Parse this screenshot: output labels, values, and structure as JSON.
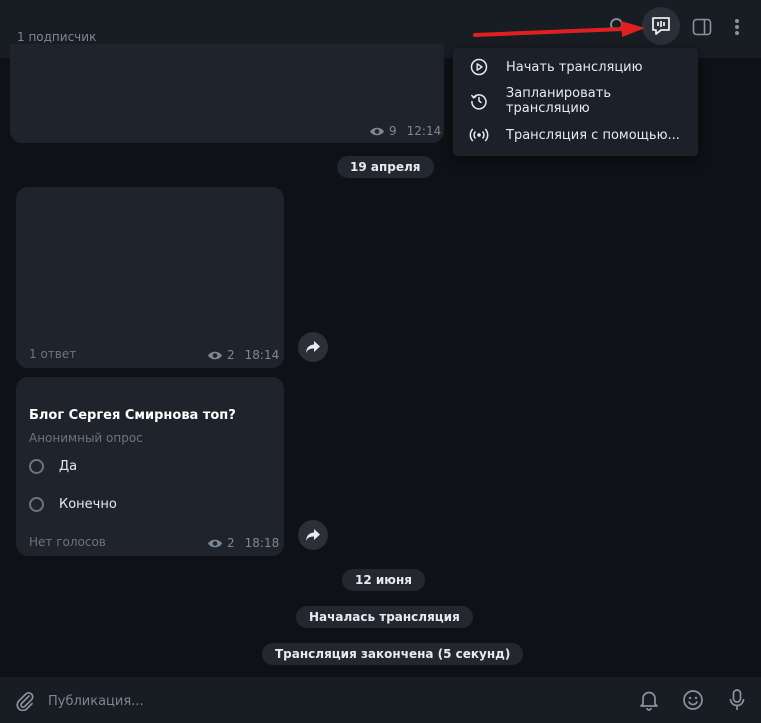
{
  "header": {
    "subscribers": "1 подписчик",
    "icons": [
      "search-icon",
      "live-stream-icon",
      "sidebar-icon",
      "more-icon"
    ]
  },
  "live_menu": {
    "items": [
      {
        "label": "Начать трансляцию",
        "icon": "play-icon"
      },
      {
        "label": "Запланировать трансляцию",
        "icon": "schedule-icon"
      },
      {
        "label": "Трансляция с помощью...",
        "icon": "broadcast-icon"
      }
    ]
  },
  "messages": {
    "m1": {
      "views": "9",
      "time": "12:14"
    },
    "date1": "19 апреля",
    "m2": {
      "reply": "1 ответ",
      "views": "2",
      "time": "18:14"
    },
    "m3": {
      "question": "Блог Сергея Смирнова топ?",
      "type": "Анонимный опрос",
      "options": [
        "Да",
        "Конечно"
      ],
      "votes": "Нет голосов",
      "views": "2",
      "time": "18:18"
    },
    "date2": "12 июня",
    "service1": "Началась трансляция",
    "service2": "Трансляция закончена (5 секунд)"
  },
  "composer": {
    "placeholder": "Публикация..."
  },
  "colors": {
    "background": "#0f1116",
    "bubble": "#1f232b",
    "header": "#181c23",
    "annotation_arrow": "#e02020"
  }
}
